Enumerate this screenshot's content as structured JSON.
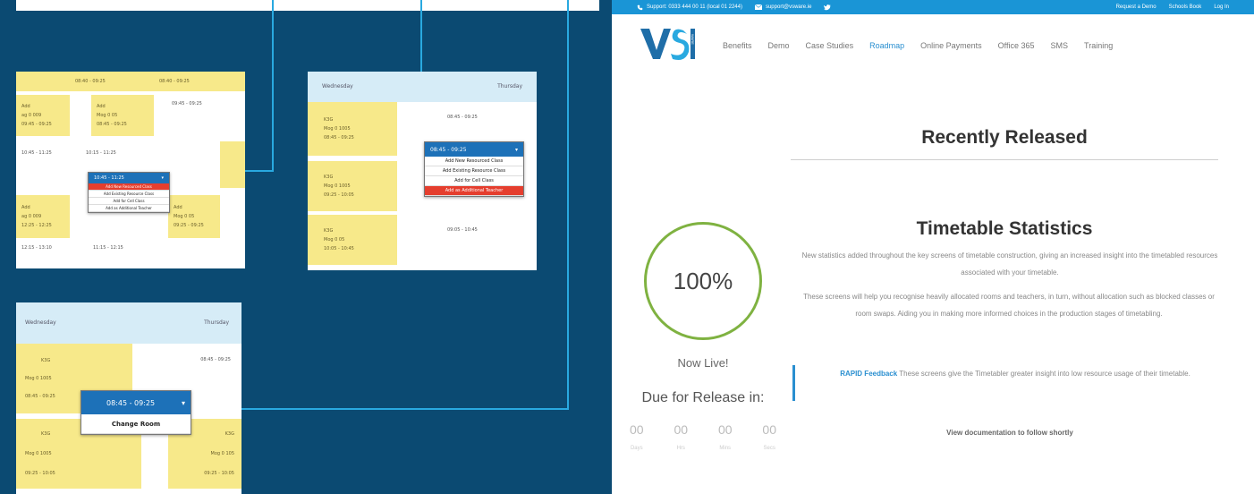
{
  "thumbs": {
    "a": {
      "cells": [
        "08:40 - 09:25",
        "08:40 - 09:25",
        "Add",
        "Add",
        "09:45 - 09:25",
        "ag 0 009",
        "Mog 0 05",
        "08:45 - 09:25",
        "09:45 - 09:25",
        "10:45 - 11:25",
        "10:15 - 11:25",
        "Add",
        "Add",
        "ag 0 009",
        "Mog 0 05",
        "12:25 - 12:25",
        "09:25 - 09:25",
        "12:15 - 13:10",
        "11:15 - 12:15"
      ],
      "popup_title": "10:45 - 11:25",
      "popup_items": [
        "Add New Resourced Class",
        "Add Existing Resource Class",
        "Add for Cell Class",
        "Add as Additional Teacher"
      ]
    },
    "b": {
      "head_left": "Wednesday",
      "head_right": "Thursday",
      "cells": [
        "K3G",
        "Mog 0 1005",
        "08:45 - 09:25",
        "08:45 - 09:25",
        "K3G",
        "Mog 0 1005",
        "09:25 - 10:05",
        "K3G",
        "Mog 0 05",
        "10:05 - 10:45",
        "09:05 - 10:45"
      ],
      "popup_title": "08:45 - 09:25",
      "popup_items": [
        "Add New Resourced Class",
        "Add Existing Resource Class",
        "Add for Cell Class",
        "Add as Additional Teacher"
      ]
    },
    "c": {
      "head_left": "Wednesday",
      "head_right": "Thursday",
      "cells": [
        "K3G",
        "Mog 0 1005",
        "08:45 - 09:25",
        "08:45 - 09:25",
        "K3G",
        "Mog 0 1005",
        "09:25 - 10:05",
        "K3G",
        "Mog 0 105",
        "09:25 - 10:05"
      ],
      "popup_title": "08:45 - 09:25",
      "popup_items": [
        "Change Room"
      ]
    }
  },
  "site": {
    "topbar": {
      "phone": "Support: 0333 444 00 11 (local 01 2244)",
      "email": "support@vsware.ie",
      "right_links": [
        "Request a Demo",
        "Schools Book",
        "Log In"
      ]
    },
    "logo_text": "VS",
    "logo_sub": "WARE",
    "menu": [
      "Benefits",
      "Demo",
      "Case Studies",
      "Roadmap",
      "Online Payments",
      "Office 365",
      "SMS",
      "Training"
    ],
    "menu_active": 3,
    "section_title": "Recently Released",
    "feature_title": "Timetable Statistics",
    "paragraphs": [
      "New statistics added throughout the key screens of timetable construction, giving an increased insight into the timetabled resources associated with your timetable.",
      "These screens will help you recognise heavily allocated rooms and teachers, in turn, without allocation such as blocked classes or room swaps. Aiding you in making more informed choices in the production stages of timetabling."
    ],
    "quote_label": "RAPID Feedback",
    "quote_text": "These screens give the Timetabler greater insight into low resource usage of their timetable.",
    "footer_text": "View documentation to follow shortly",
    "progress": "100%",
    "status": "Now Live!",
    "release_label": "Due for Release in:",
    "countdown": [
      "00",
      "00",
      "00",
      "00"
    ],
    "countdown_units": [
      "Days",
      "Hrs",
      "Mins",
      "Secs"
    ]
  },
  "colors": {
    "navy": "#0b4a72",
    "accent": "#29a9e0",
    "yellow": "#f7e98a",
    "popup_blue": "#1d71b8",
    "red": "#e53e2e",
    "green_ring": "#7fb241",
    "link_blue": "#2a8fd0"
  },
  "icons": [
    "phone-icon",
    "mail-icon",
    "twitter-icon",
    "chevron-down-icon"
  ]
}
